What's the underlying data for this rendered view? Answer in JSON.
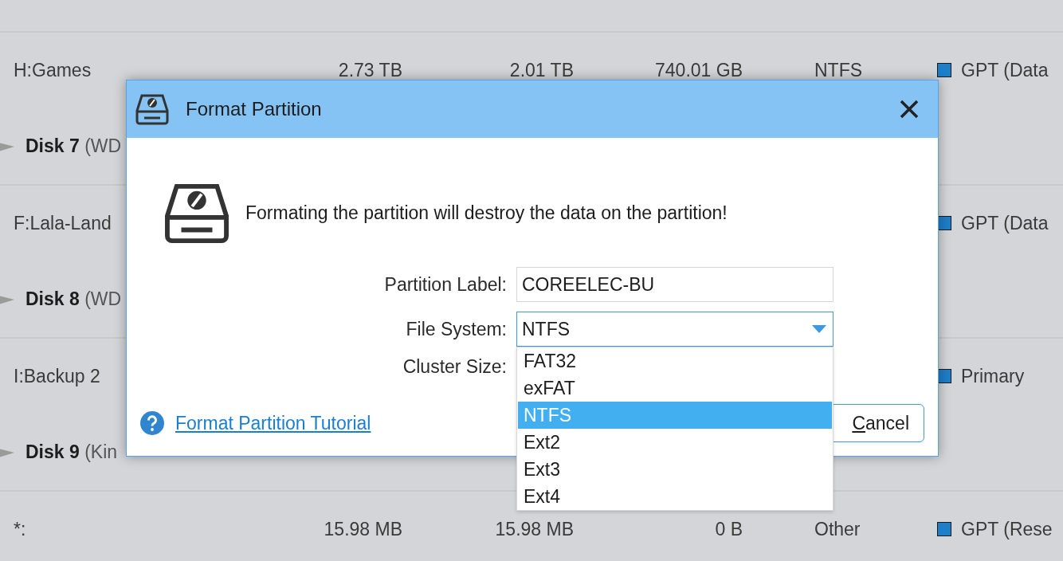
{
  "background_list": {
    "rows": [
      {
        "kind": "partition",
        "name": "H:Games",
        "total": "2.73 TB",
        "used": "2.01 TB",
        "unused": "740.01 GB",
        "file_system": "NTFS",
        "type": "GPT (Data"
      },
      {
        "kind": "disk",
        "name": "Disk 7",
        "model": "(WD"
      },
      {
        "kind": "partition",
        "name": "F:Lala-Land",
        "type": "GPT (Data"
      },
      {
        "kind": "disk",
        "name": "Disk 8",
        "model": "(WD"
      },
      {
        "kind": "partition",
        "name": "I:Backup 2",
        "type": "Primary"
      },
      {
        "kind": "disk",
        "name": "Disk 9",
        "model": "(Kin"
      },
      {
        "kind": "partition",
        "name": "*:",
        "total": "15.98 MB",
        "used": "15.98 MB",
        "unused": "0 B",
        "file_system": "Other",
        "type": "GPT (Rese"
      }
    ]
  },
  "dialog": {
    "title": "Format Partition",
    "warning": "Formating the partition will destroy the data on the partition!",
    "fields": [
      {
        "kind": "text",
        "label": "Partition Label:",
        "value": "COREELEC-BU"
      },
      {
        "kind": "select",
        "label": "File System:",
        "value": "NTFS",
        "expanded": true,
        "options": [
          {
            "label": "FAT32",
            "selected": false
          },
          {
            "label": "exFAT",
            "selected": false
          },
          {
            "label": "NTFS",
            "selected": true
          },
          {
            "label": "Ext2",
            "selected": false
          },
          {
            "label": "Ext3",
            "selected": false
          },
          {
            "label": "Ext4",
            "selected": false
          }
        ]
      },
      {
        "kind": "hidden",
        "label": "Cluster Size:"
      }
    ],
    "tutorial_link": "Format Partition Tutorial",
    "buttons": [
      "Cancel"
    ]
  }
}
